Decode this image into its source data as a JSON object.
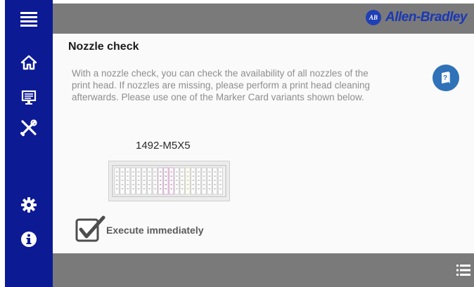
{
  "header": {
    "brand": "Allen-Bradley",
    "brand_mark": "AB"
  },
  "sidebar": {
    "items": [
      {
        "icon": "menu-icon"
      },
      {
        "icon": "home-icon"
      },
      {
        "icon": "monitor-icon"
      },
      {
        "icon": "tools-icon"
      },
      {
        "icon": "gear-icon"
      },
      {
        "icon": "info-icon"
      }
    ]
  },
  "page": {
    "title": "Nozzle check",
    "description": "With a nozzle check, you can check the availability of all nozzles of the print head. If nozzles are missing, please perform a print head cleaning afterwards. Please use one of the Marker Card variants shown below.",
    "card_variant": "1492-M5X5",
    "execute_label": "Execute immediately",
    "execute_checked": true
  },
  "colors": {
    "sidebar": "#0c1a94",
    "bars": "#7a7a7a",
    "accent": "#2f72b7",
    "brand": "#1a38b5"
  }
}
